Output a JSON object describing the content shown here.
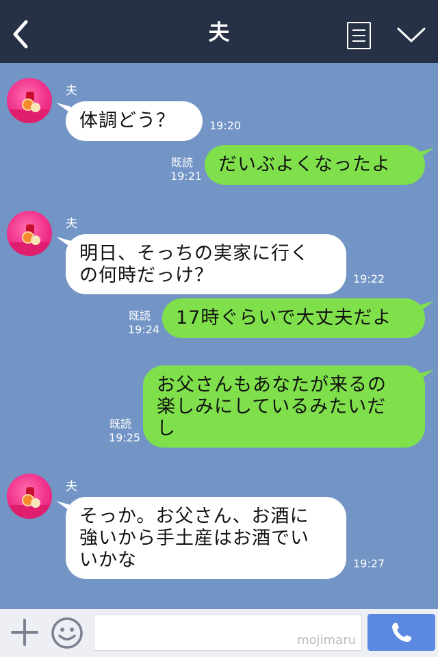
{
  "header": {
    "title": "夫",
    "back_icon": "chevron-left-icon",
    "menu_icon": "list-icon",
    "collapse_icon": "chevron-down-icon"
  },
  "messages": [
    {
      "side": "left",
      "sender": "夫",
      "text": "体調どう？",
      "time": "19:20"
    },
    {
      "side": "right",
      "text": "だいぶよくなったよ",
      "read": "既読",
      "time": "19:21"
    },
    {
      "side": "left",
      "sender": "夫",
      "text": "明日、そっちの実家に行く\nの何時だっけ？",
      "time": "19:22"
    },
    {
      "side": "right",
      "text": "17時ぐらいで大丈夫だよ",
      "read": "既読",
      "time": "19:24"
    },
    {
      "side": "right",
      "text": "お父さんもあなたが来るの\n楽しみにしているみたいだ\nし",
      "read": "既読",
      "time": "19:25"
    },
    {
      "side": "left",
      "sender": "夫",
      "text": "そっか。お父さん、お酒に\n強いから手土産はお酒でい\nいかな",
      "time": "19:27"
    }
  ],
  "footer": {
    "plus_icon": "plus-icon",
    "emoji_icon": "smiley-icon",
    "input_value": "",
    "watermark": "mojimaru",
    "send_icon": "phone-icon"
  },
  "colors": {
    "header_bg": "#273146",
    "chat_bg": "#7395c5",
    "bubble_left": "#ffffff",
    "bubble_right": "#7fe04c",
    "send_button": "#5b88e0"
  }
}
